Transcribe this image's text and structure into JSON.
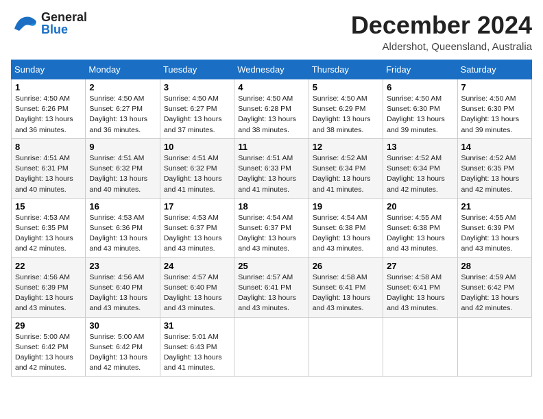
{
  "header": {
    "logo_general": "General",
    "logo_blue": "Blue",
    "month_title": "December 2024",
    "subtitle": "Aldershot, Queensland, Australia"
  },
  "calendar": {
    "days_of_week": [
      "Sunday",
      "Monday",
      "Tuesday",
      "Wednesday",
      "Thursday",
      "Friday",
      "Saturday"
    ],
    "weeks": [
      [
        null,
        null,
        null,
        null,
        null,
        null,
        null
      ]
    ],
    "cells": [
      {
        "day": null
      },
      {
        "day": null
      },
      {
        "day": null
      },
      {
        "day": null
      },
      {
        "day": null
      },
      {
        "day": null
      },
      {
        "day": null
      },
      {
        "day": "1",
        "sunrise": "4:50 AM",
        "sunset": "6:26 PM",
        "daylight": "13 hours and 36 minutes."
      },
      {
        "day": "2",
        "sunrise": "4:50 AM",
        "sunset": "6:27 PM",
        "daylight": "13 hours and 36 minutes."
      },
      {
        "day": "3",
        "sunrise": "4:50 AM",
        "sunset": "6:27 PM",
        "daylight": "13 hours and 37 minutes."
      },
      {
        "day": "4",
        "sunrise": "4:50 AM",
        "sunset": "6:28 PM",
        "daylight": "13 hours and 38 minutes."
      },
      {
        "day": "5",
        "sunrise": "4:50 AM",
        "sunset": "6:29 PM",
        "daylight": "13 hours and 38 minutes."
      },
      {
        "day": "6",
        "sunrise": "4:50 AM",
        "sunset": "6:30 PM",
        "daylight": "13 hours and 39 minutes."
      },
      {
        "day": "7",
        "sunrise": "4:50 AM",
        "sunset": "6:30 PM",
        "daylight": "13 hours and 39 minutes."
      },
      {
        "day": "8",
        "sunrise": "4:51 AM",
        "sunset": "6:31 PM",
        "daylight": "13 hours and 40 minutes."
      },
      {
        "day": "9",
        "sunrise": "4:51 AM",
        "sunset": "6:32 PM",
        "daylight": "13 hours and 40 minutes."
      },
      {
        "day": "10",
        "sunrise": "4:51 AM",
        "sunset": "6:32 PM",
        "daylight": "13 hours and 41 minutes."
      },
      {
        "day": "11",
        "sunrise": "4:51 AM",
        "sunset": "6:33 PM",
        "daylight": "13 hours and 41 minutes."
      },
      {
        "day": "12",
        "sunrise": "4:52 AM",
        "sunset": "6:34 PM",
        "daylight": "13 hours and 41 minutes."
      },
      {
        "day": "13",
        "sunrise": "4:52 AM",
        "sunset": "6:34 PM",
        "daylight": "13 hours and 42 minutes."
      },
      {
        "day": "14",
        "sunrise": "4:52 AM",
        "sunset": "6:35 PM",
        "daylight": "13 hours and 42 minutes."
      },
      {
        "day": "15",
        "sunrise": "4:53 AM",
        "sunset": "6:35 PM",
        "daylight": "13 hours and 42 minutes."
      },
      {
        "day": "16",
        "sunrise": "4:53 AM",
        "sunset": "6:36 PM",
        "daylight": "13 hours and 43 minutes."
      },
      {
        "day": "17",
        "sunrise": "4:53 AM",
        "sunset": "6:37 PM",
        "daylight": "13 hours and 43 minutes."
      },
      {
        "day": "18",
        "sunrise": "4:54 AM",
        "sunset": "6:37 PM",
        "daylight": "13 hours and 43 minutes."
      },
      {
        "day": "19",
        "sunrise": "4:54 AM",
        "sunset": "6:38 PM",
        "daylight": "13 hours and 43 minutes."
      },
      {
        "day": "20",
        "sunrise": "4:55 AM",
        "sunset": "6:38 PM",
        "daylight": "13 hours and 43 minutes."
      },
      {
        "day": "21",
        "sunrise": "4:55 AM",
        "sunset": "6:39 PM",
        "daylight": "13 hours and 43 minutes."
      },
      {
        "day": "22",
        "sunrise": "4:56 AM",
        "sunset": "6:39 PM",
        "daylight": "13 hours and 43 minutes."
      },
      {
        "day": "23",
        "sunrise": "4:56 AM",
        "sunset": "6:40 PM",
        "daylight": "13 hours and 43 minutes."
      },
      {
        "day": "24",
        "sunrise": "4:57 AM",
        "sunset": "6:40 PM",
        "daylight": "13 hours and 43 minutes."
      },
      {
        "day": "25",
        "sunrise": "4:57 AM",
        "sunset": "6:41 PM",
        "daylight": "13 hours and 43 minutes."
      },
      {
        "day": "26",
        "sunrise": "4:58 AM",
        "sunset": "6:41 PM",
        "daylight": "13 hours and 43 minutes."
      },
      {
        "day": "27",
        "sunrise": "4:58 AM",
        "sunset": "6:41 PM",
        "daylight": "13 hours and 43 minutes."
      },
      {
        "day": "28",
        "sunrise": "4:59 AM",
        "sunset": "6:42 PM",
        "daylight": "13 hours and 42 minutes."
      },
      {
        "day": "29",
        "sunrise": "5:00 AM",
        "sunset": "6:42 PM",
        "daylight": "13 hours and 42 minutes."
      },
      {
        "day": "30",
        "sunrise": "5:00 AM",
        "sunset": "6:42 PM",
        "daylight": "13 hours and 42 minutes."
      },
      {
        "day": "31",
        "sunrise": "5:01 AM",
        "sunset": "6:43 PM",
        "daylight": "13 hours and 41 minutes."
      },
      null,
      null,
      null,
      null
    ],
    "labels": {
      "sunrise": "Sunrise:",
      "sunset": "Sunset:",
      "daylight": "Daylight:"
    }
  }
}
